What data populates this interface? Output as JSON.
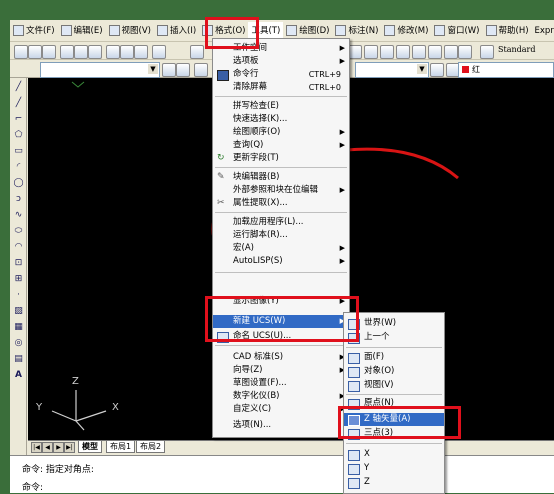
{
  "menubar": {
    "items": [
      {
        "label": "文件(F)"
      },
      {
        "label": "编辑(E)"
      },
      {
        "label": "视图(V)"
      },
      {
        "label": "插入(I)"
      },
      {
        "label": "格式(O)"
      },
      {
        "label": "工具(T)"
      },
      {
        "label": "绘图(D)"
      },
      {
        "label": "标注(N)"
      },
      {
        "label": "修改(M)"
      },
      {
        "label": "窗口(W)"
      },
      {
        "label": "帮助(H)"
      },
      {
        "label": "Express"
      }
    ]
  },
  "toolbar": {
    "text_style": "Standard",
    "layer_color": "红"
  },
  "tools_menu": {
    "items": [
      {
        "label": "工作空间"
      },
      {
        "label": "选项板"
      },
      {
        "label": "命令行",
        "shortcut": "CTRL+9"
      },
      {
        "label": "清除屏幕",
        "shortcut": "CTRL+0"
      },
      {
        "label": "拼写检查(E)"
      },
      {
        "label": "快速选择(K)..."
      },
      {
        "label": "绘图顺序(O)"
      },
      {
        "label": "查询(Q)"
      },
      {
        "label": "更新字段(T)"
      },
      {
        "label": "块编辑器(B)"
      },
      {
        "label": "外部参照和块在位编辑"
      },
      {
        "label": "属性提取(X)..."
      },
      {
        "label": "加载应用程序(L)..."
      },
      {
        "label": "运行脚本(R)..."
      },
      {
        "label": "宏(A)"
      },
      {
        "label": "AutoLISP(S)"
      },
      {
        "label": "显示图像(Y)"
      },
      {
        "label": "新建 UCS(W)"
      },
      {
        "label": "命名 UCS(U)..."
      },
      {
        "label": "CAD 标准(S)"
      },
      {
        "label": "向导(Z)"
      },
      {
        "label": "草图设置(F)..."
      },
      {
        "label": "数字化仪(B)"
      },
      {
        "label": "自定义(C)"
      },
      {
        "label": "选项(N)..."
      }
    ]
  },
  "ucs_submenu": {
    "items": [
      {
        "label": "世界(W)"
      },
      {
        "label": "上一个"
      },
      {
        "label": "面(F)"
      },
      {
        "label": "对象(O)"
      },
      {
        "label": "视图(V)"
      },
      {
        "label": "原点(N)"
      },
      {
        "label": "Z 轴矢量(A)"
      },
      {
        "label": "三点(3)"
      },
      {
        "label": "X"
      },
      {
        "label": "Y"
      },
      {
        "label": "Z"
      }
    ]
  },
  "ucs_icon": {
    "x": "X",
    "y": "Y",
    "z": "Z"
  },
  "layout_tabs": [
    "模型",
    "布局1",
    "布局2"
  ],
  "command_lines": [
    "命令: 指定对角点:",
    "命令:"
  ],
  "colors": {
    "highlight": "#316ac5",
    "annotation": "#e0101c",
    "canvas": "#000000"
  }
}
